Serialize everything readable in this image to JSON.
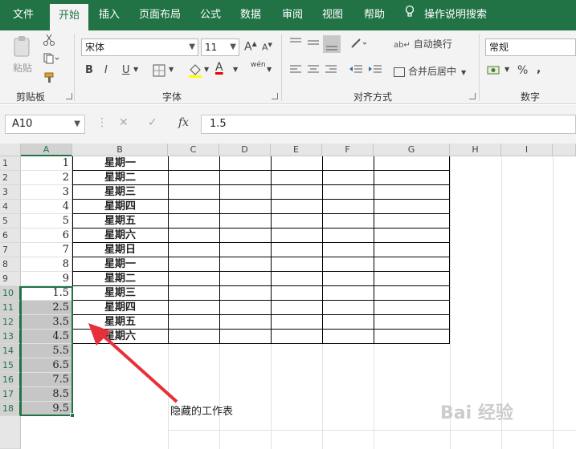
{
  "tabs": {
    "file": "文件",
    "home": "开始",
    "insert": "插入",
    "page_layout": "页面布局",
    "formulas": "公式",
    "data": "数据",
    "review": "审阅",
    "view": "视图",
    "help": "帮助",
    "tell_me": "操作说明搜索"
  },
  "ribbon": {
    "clipboard": {
      "paste": "粘贴",
      "label": "剪贴板"
    },
    "font": {
      "name": "宋体",
      "size": "11",
      "grow": "A",
      "shrink": "A",
      "bold": "B",
      "italic": "I",
      "underline": "U",
      "color_letter": "A",
      "phonetic": "wén",
      "label": "字体"
    },
    "alignment": {
      "wrap_text": "自动换行",
      "merge_center": "合并后居中",
      "label": "对齐方式"
    },
    "number": {
      "format": "常规",
      "percent": "%",
      "comma": ",",
      "label": "数字"
    }
  },
  "formula_bar": {
    "name_box": "A10",
    "fx": "fx",
    "value": "1.5"
  },
  "columns": [
    "A",
    "B",
    "C",
    "D",
    "E",
    "F",
    "G",
    "H",
    "I"
  ],
  "rows": [
    {
      "n": "1",
      "a": "1",
      "b": "星期一"
    },
    {
      "n": "2",
      "a": "2",
      "b": "星期二"
    },
    {
      "n": "3",
      "a": "3",
      "b": "星期三"
    },
    {
      "n": "4",
      "a": "4",
      "b": "星期四"
    },
    {
      "n": "5",
      "a": "5",
      "b": "星期五"
    },
    {
      "n": "6",
      "a": "6",
      "b": "星期六"
    },
    {
      "n": "7",
      "a": "7",
      "b": "星期日"
    },
    {
      "n": "8",
      "a": "8",
      "b": "星期一"
    },
    {
      "n": "9",
      "a": "9",
      "b": "星期二"
    },
    {
      "n": "10",
      "a": "1.5",
      "b": "星期三"
    },
    {
      "n": "11",
      "a": "2.5",
      "b": "星期四"
    },
    {
      "n": "12",
      "a": "3.5",
      "b": "星期五"
    },
    {
      "n": "13",
      "a": "4.5",
      "b": "星期六"
    },
    {
      "n": "14",
      "a": "5.5",
      "b": ""
    },
    {
      "n": "15",
      "a": "6.5",
      "b": ""
    },
    {
      "n": "16",
      "a": "7.5",
      "b": ""
    },
    {
      "n": "17",
      "a": "8.5",
      "b": ""
    },
    {
      "n": "18",
      "a": "9.5",
      "b": ""
    }
  ],
  "annotation": "隐藏的工作表",
  "watermark": "Bai 经验",
  "colors": {
    "accent": "#217346",
    "arrow": "#e8303a",
    "selection": "#c6c6c6"
  }
}
